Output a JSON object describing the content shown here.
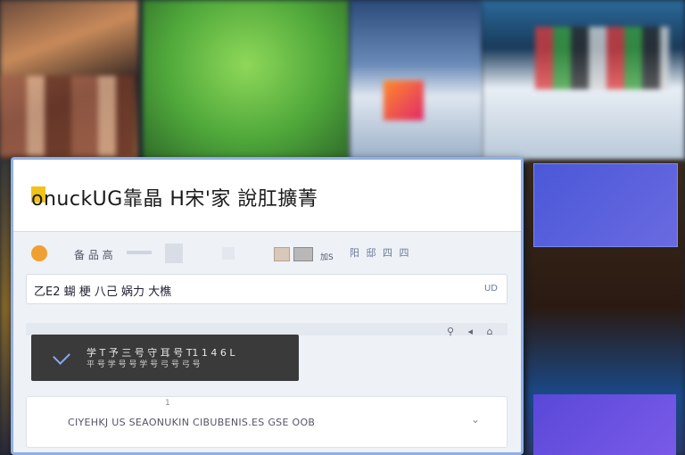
{
  "window": {
    "title": "onuckUG靠晶 H宋'家 說肛擴菁"
  },
  "toolbar": {
    "label": "备 品 高",
    "small_label": "加S",
    "right_label": "阳 邸 四 四"
  },
  "address": {
    "text": "乙E2 蝴 梗 八己 娲力 大樵",
    "right_text": "UD"
  },
  "notification": {
    "line1": "学 T 予 三 号 守 耳 号 T1 1 4 6 L",
    "line2": "平 号 学 号 号 学 号 弓 号 弓 号"
  },
  "panel": {
    "text": "CIYEHKJ US SEAONUKIN CIBUBENIS.ES GSE OOB",
    "tick": "1"
  },
  "colors": {
    "window_border": "#8fb0e8",
    "accent_yellow": "#f2c21a",
    "dark_card": "#3a3a3a"
  }
}
